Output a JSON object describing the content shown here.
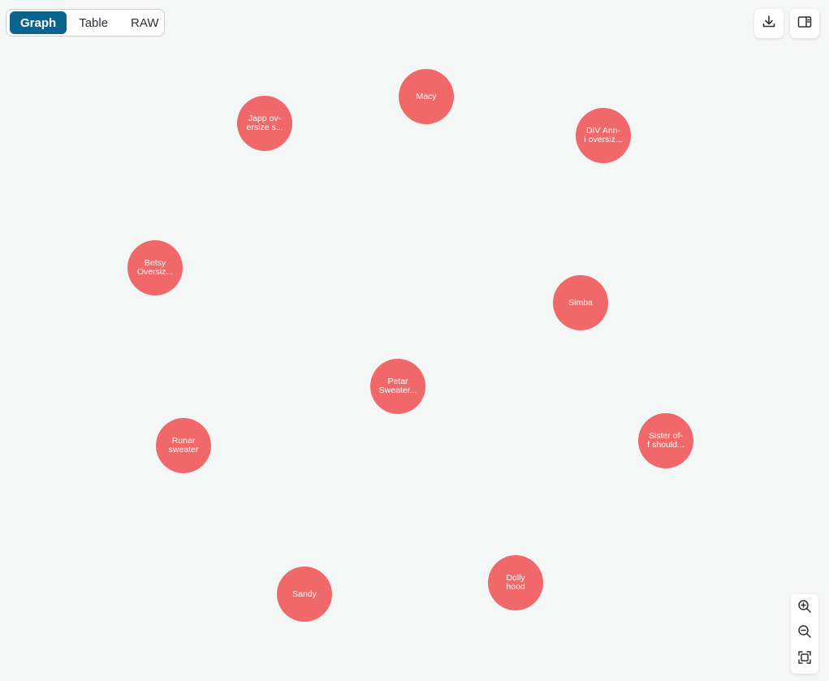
{
  "view_tabs": [
    {
      "label": "Graph",
      "active": true
    },
    {
      "label": "Table",
      "active": false
    },
    {
      "label": "RAW",
      "active": false
    }
  ],
  "toolbar": {
    "download_icon": "download-icon",
    "panel_icon": "side-panel-icon"
  },
  "zoom": {
    "zoom_in_icon": "zoom-in-icon",
    "zoom_out_icon": "zoom-out-icon",
    "fit_icon": "fit-to-screen-icon"
  },
  "colors": {
    "node": "#f0686a",
    "accent": "#0b6490",
    "background": "#f5f6f6"
  },
  "nodes": [
    {
      "label": "Macy"
    },
    {
      "label": "Japp ov-\nersize s..."
    },
    {
      "label": "DIV Ann-\ni oversiz..."
    },
    {
      "label": "Betsy\nOversiz..."
    },
    {
      "label": "Simba"
    },
    {
      "label": "Petar\nSweater..."
    },
    {
      "label": "Runar\nsweater"
    },
    {
      "label": "Sister of-\nf should..."
    },
    {
      "label": "Dolly\nhood"
    },
    {
      "label": "Sandy"
    }
  ]
}
